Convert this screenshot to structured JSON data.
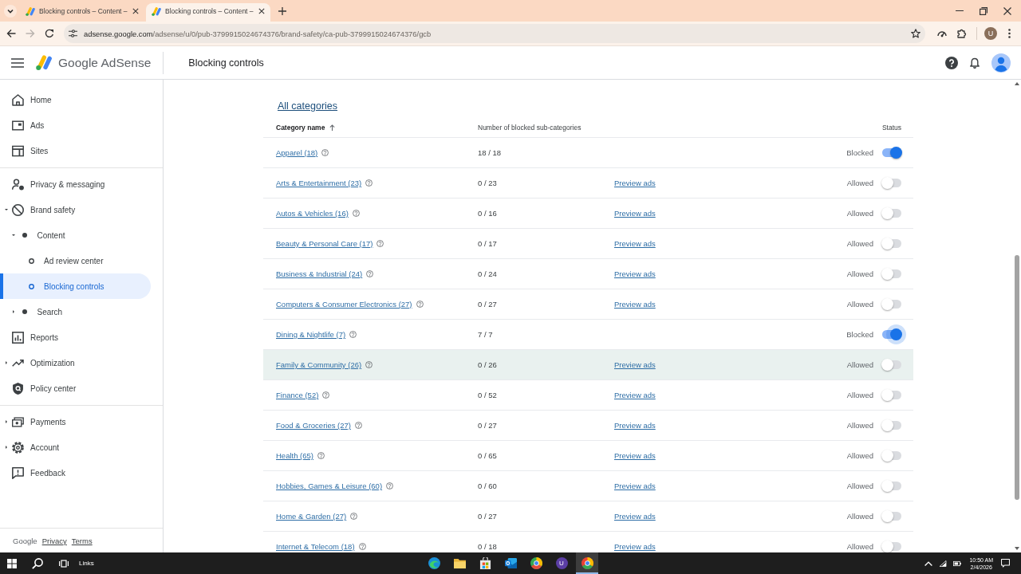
{
  "browser": {
    "tabs": [
      {
        "title": "Blocking controls – Content –",
        "selected": false
      },
      {
        "title": "Blocking controls – Content –",
        "selected": true
      }
    ],
    "address": {
      "host": "adsense.google.com",
      "path": "/adsense/u/0/pub-3799915024674376/brand-safety/ca-pub-3799915024674376/gcb"
    },
    "profile_initial": "U"
  },
  "header": {
    "product": "Google AdSense",
    "page_title": "Blocking controls"
  },
  "sidebar": {
    "groups": [
      {
        "items": [
          {
            "label": "Home",
            "selected": false
          },
          {
            "label": "Ads",
            "selected": false
          },
          {
            "label": "Sites",
            "selected": false
          }
        ]
      },
      {
        "items": [
          {
            "label": "Privacy & messaging",
            "selected": false
          },
          {
            "label": "Brand safety",
            "selected": false,
            "expanded": true,
            "children": [
              {
                "label": "Content",
                "selected": false,
                "expanded": true,
                "children": [
                  {
                    "label": "Ad review center",
                    "selected": false
                  },
                  {
                    "label": "Blocking controls",
                    "selected": true
                  }
                ]
              },
              {
                "label": "Search",
                "selected": false,
                "expanded": false
              }
            ]
          },
          {
            "label": "Reports",
            "selected": false
          },
          {
            "label": "Optimization",
            "selected": false,
            "expanded": false
          },
          {
            "label": "Policy center",
            "selected": false
          }
        ]
      },
      {
        "items": [
          {
            "label": "Payments",
            "selected": false,
            "expanded": false
          },
          {
            "label": "Account",
            "selected": false,
            "expanded": false
          },
          {
            "label": "Feedback",
            "selected": false
          }
        ]
      }
    ],
    "footer": {
      "brand": "Google",
      "links": [
        "Privacy",
        "Terms"
      ]
    }
  },
  "table": {
    "heading": "All categories",
    "columns": [
      {
        "label": "Category name",
        "sorted": true
      },
      {
        "label": "Number of blocked sub-categories",
        "sorted": false
      },
      {
        "label": "Status",
        "sorted": false
      }
    ],
    "rows": [
      {
        "name": "Apparel (18)",
        "blocked": "18 / 18",
        "status": "Blocked",
        "on": true,
        "hovered": false,
        "focused": false
      },
      {
        "name": "Arts & Entertainment (23)",
        "blocked": "0 / 23",
        "preview": "Preview ads",
        "status": "Allowed",
        "on": false,
        "hovered": false,
        "focused": false
      },
      {
        "name": "Autos & Vehicles (16)",
        "blocked": "0 / 16",
        "preview": "Preview ads",
        "status": "Allowed",
        "on": false,
        "hovered": false,
        "focused": false
      },
      {
        "name": "Beauty & Personal Care (17)",
        "blocked": "0 / 17",
        "preview": "Preview ads",
        "status": "Allowed",
        "on": false,
        "hovered": false,
        "focused": false
      },
      {
        "name": "Business & Industrial (24)",
        "blocked": "0 / 24",
        "preview": "Preview ads",
        "status": "Allowed",
        "on": false,
        "hovered": false,
        "focused": false
      },
      {
        "name": "Computers & Consumer Electronics (27)",
        "blocked": "0 / 27",
        "preview": "Preview ads",
        "status": "Allowed",
        "on": false,
        "hovered": false,
        "focused": false
      },
      {
        "name": "Dining & Nightlife (7)",
        "blocked": "7 / 7",
        "status": "Blocked",
        "on": true,
        "hovered": false,
        "focused": true
      },
      {
        "name": "Family & Community (26)",
        "blocked": "0 / 26",
        "preview": "Preview ads",
        "status": "Allowed",
        "on": false,
        "hovered": true,
        "focused": false
      },
      {
        "name": "Finance (52)",
        "blocked": "0 / 52",
        "preview": "Preview ads",
        "status": "Allowed",
        "on": false,
        "hovered": false,
        "focused": false
      },
      {
        "name": "Food & Groceries (27)",
        "blocked": "0 / 27",
        "preview": "Preview ads",
        "status": "Allowed",
        "on": false,
        "hovered": false,
        "focused": false
      },
      {
        "name": "Health (65)",
        "blocked": "0 / 65",
        "preview": "Preview ads",
        "status": "Allowed",
        "on": false,
        "hovered": false,
        "focused": false
      },
      {
        "name": "Hobbies, Games & Leisure (60)",
        "blocked": "0 / 60",
        "preview": "Preview ads",
        "status": "Allowed",
        "on": false,
        "hovered": false,
        "focused": false
      },
      {
        "name": "Home & Garden (27)",
        "blocked": "0 / 27",
        "preview": "Preview ads",
        "status": "Allowed",
        "on": false,
        "hovered": false,
        "focused": false
      },
      {
        "name": "Internet & Telecom (18)",
        "blocked": "0 / 18",
        "preview": "Preview ads",
        "status": "Allowed",
        "on": false,
        "hovered": false,
        "focused": false
      }
    ]
  },
  "taskbar": {
    "label": "Links",
    "apps": [
      {
        "selected": false
      },
      {
        "selected": false
      },
      {
        "selected": false
      },
      {
        "selected": false
      },
      {
        "selected": false
      },
      {
        "selected": false,
        "letter": "U"
      },
      {
        "selected": true
      }
    ],
    "time": "10:50 AM",
    "date": "2/4/2026"
  }
}
